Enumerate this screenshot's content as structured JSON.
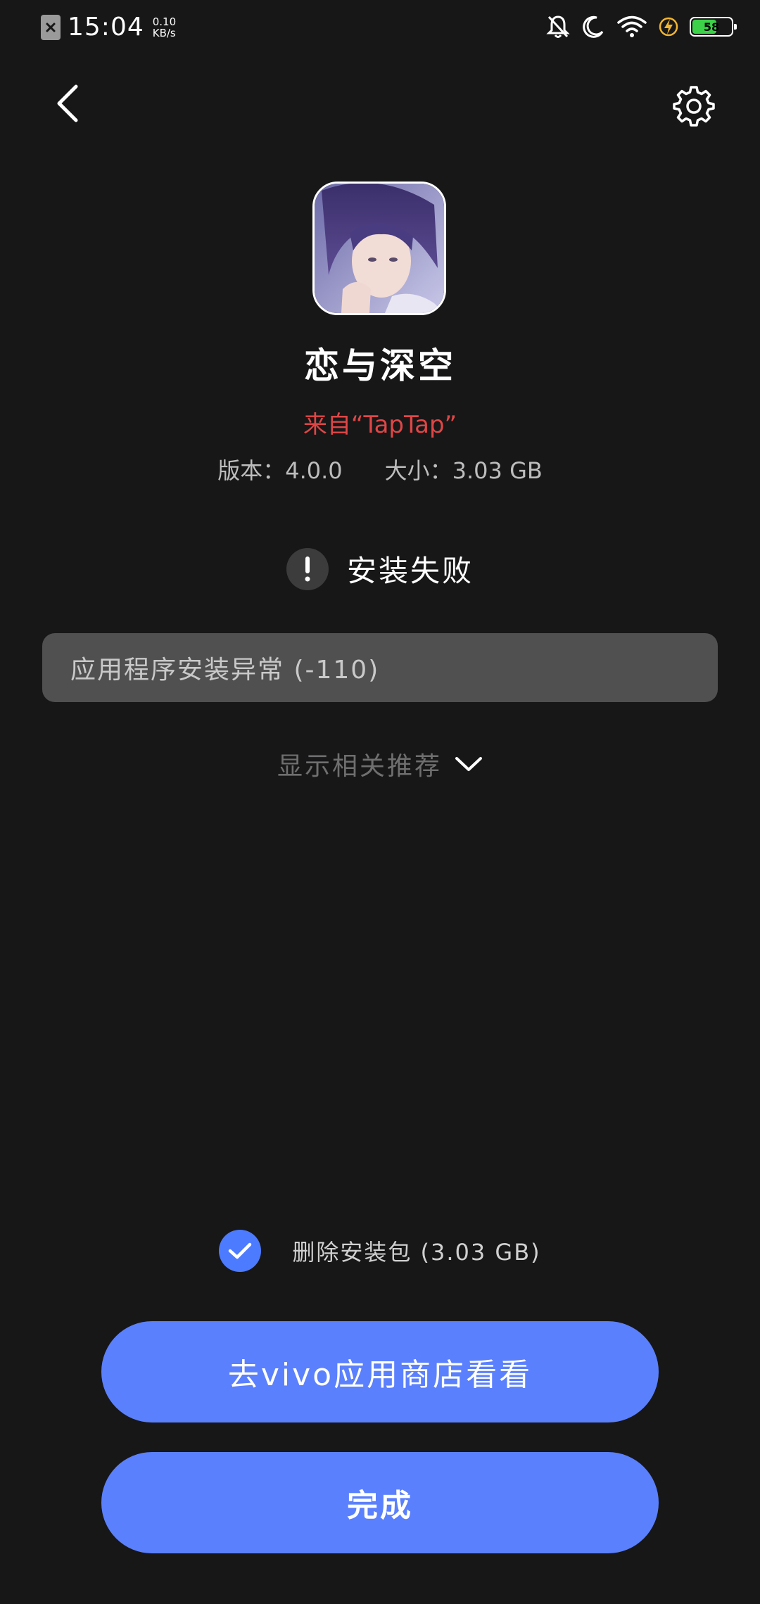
{
  "status_bar": {
    "time": "15:04",
    "net_speed_value": "0.10",
    "net_speed_unit": "KB/s",
    "battery_level": "58",
    "battery_color": "#3dd14a",
    "icons": [
      "sim-disabled-icon",
      "mute-bell-icon",
      "moon-icon",
      "wifi-icon",
      "charging-icon",
      "battery-icon"
    ]
  },
  "header": {
    "back_icon": "chevron-left-icon",
    "settings_icon": "gear-icon"
  },
  "app": {
    "name": "恋与深空",
    "source": "来自“TapTap”",
    "version_label": "版本：",
    "version": "4.0.0",
    "size_label": "大小：",
    "size": "3.03 GB"
  },
  "install": {
    "status_icon": "exclamation-icon",
    "status_text": "安装失败",
    "error_message": "应用程序安装异常 (-110)"
  },
  "recommend": {
    "label": "显示相关推荐",
    "icon": "chevron-down-icon"
  },
  "delete_package": {
    "checked": true,
    "label": "删除安装包 (3.03 GB)"
  },
  "buttons": {
    "store": "去vivo应用商店看看",
    "done": "完成"
  },
  "colors": {
    "background": "#171718",
    "accent": "#5b80fd",
    "source_text": "#e04646",
    "error_box": "#505050"
  }
}
